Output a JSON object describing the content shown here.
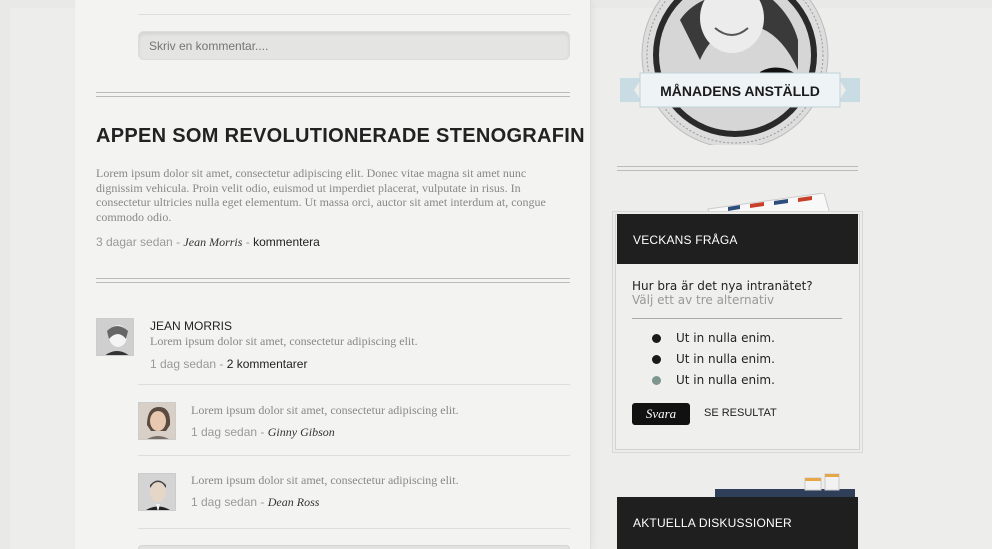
{
  "comment_form": {
    "placeholder": "Skriv en kommentar...."
  },
  "article": {
    "title": "APPEN SOM REVOLUTIONERADE STENOGRAFIN",
    "body": "Lorem ipsum dolor sit amet, consectetur adipiscing elit. Donec vitae magna sit amet nunc dignissim vehicula. Proin velit odio, euismod ut imperdiet placerat, vulputate in risus. In consectetur ultricies nulla eget elementum. Ut massa orci, auctor sit amet interdum at, congue commodo odio.",
    "time": "3 dagar sedan",
    "sep": "-",
    "author": "Jean Morris",
    "comment_link": "kommentera"
  },
  "comments": [
    {
      "name": "JEAN MORRIS",
      "text": "Lorem ipsum dolor sit amet, consectetur adipiscing elit.",
      "time": "1 dag sedan",
      "sep": "-",
      "link": "2 kommentarer"
    },
    {
      "text": "Lorem ipsum dolor sit amet, consectetur adipiscing elit.",
      "time": "1 dag sedan",
      "sep": "-",
      "author": "Ginny Gibson"
    },
    {
      "text": "Lorem ipsum dolor sit amet, consectetur adipiscing elit.",
      "time": "1 dag sedan",
      "sep": "-",
      "author": "Dean Ross"
    }
  ],
  "employee_of_month": {
    "label": "MÅNADENS ANSTÄLLD"
  },
  "poll": {
    "header": "VECKANS FRÅGA",
    "question": "Hur bra är det nya intranätet?",
    "hint": "Välj ett av tre alternativ",
    "options": [
      {
        "label": "Ut in nulla enim."
      },
      {
        "label": "Ut in nulla enim."
      },
      {
        "label": "Ut in nulla enim."
      }
    ],
    "vote_label": "Svara",
    "results_label": "SE RESULTAT",
    "accent_color": "#7d9690"
  },
  "discussions": {
    "header": "AKTUELLA DISKUSSIONER"
  }
}
